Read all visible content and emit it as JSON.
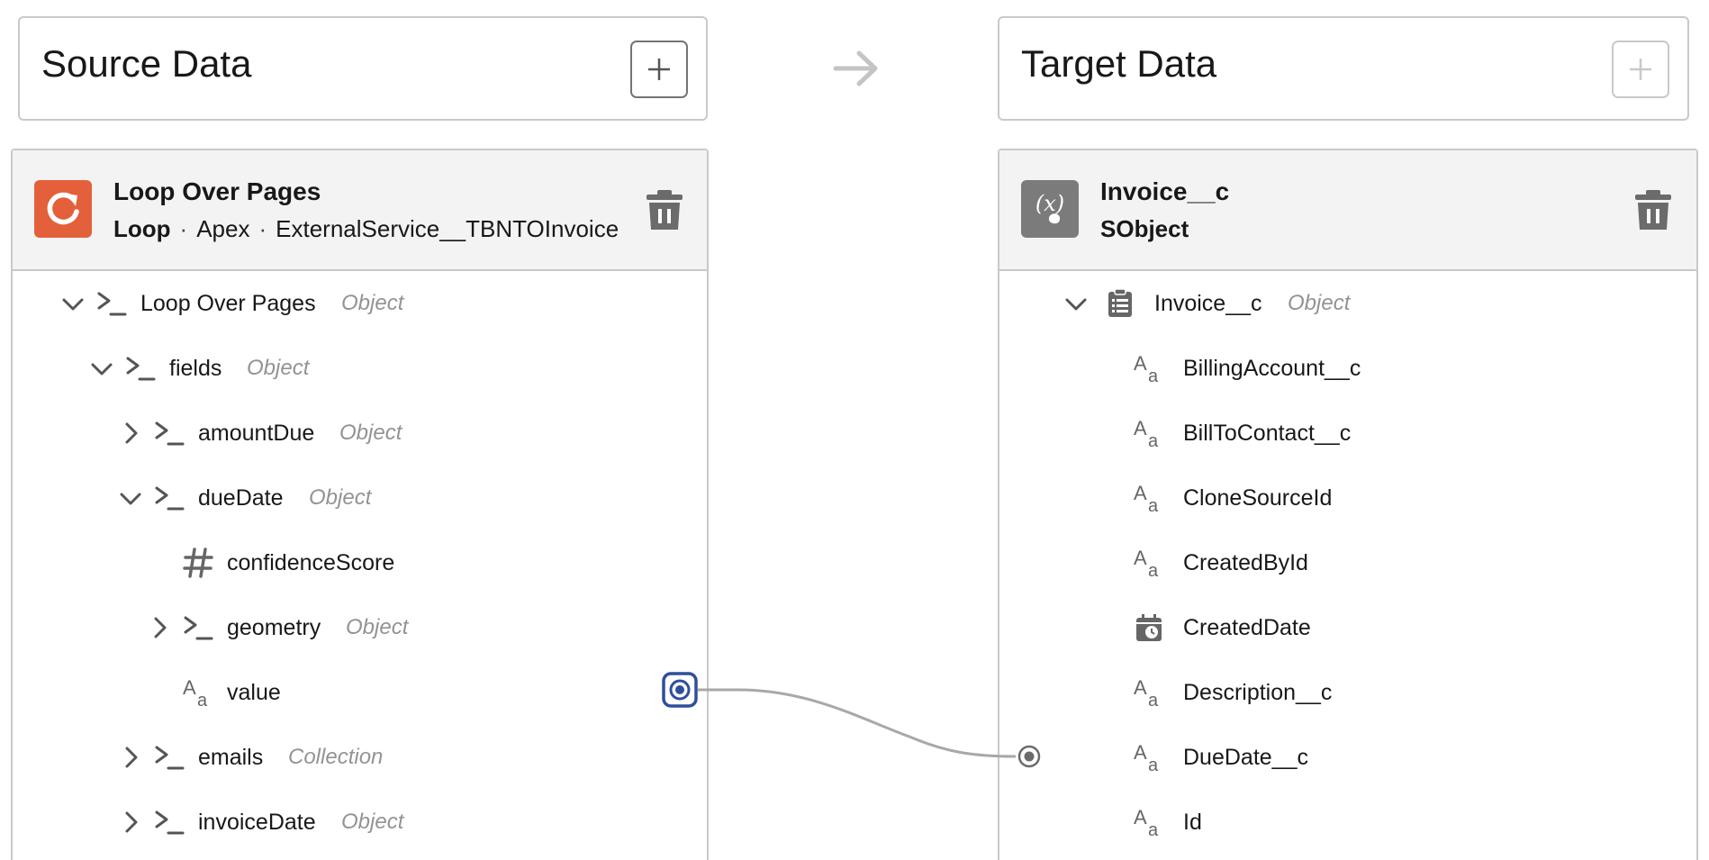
{
  "source_header": {
    "title": "Source Data"
  },
  "target_header": {
    "title": "Target Data"
  },
  "source_node": {
    "title": "Loop Over Pages",
    "type": "Loop",
    "origin": "Apex",
    "service": "ExternalService__TBNTOInvoice",
    "icon_color": "#e4603a"
  },
  "target_node": {
    "title": "Invoice__c",
    "type": "SObject",
    "icon_color": "#7b7b7b"
  },
  "source_tree": [
    {
      "label": "Loop Over Pages",
      "type": "Object",
      "icon": "formula-icon",
      "chevron": "down"
    },
    {
      "label": "fields",
      "type": "Object",
      "icon": "formula-icon",
      "chevron": "down"
    },
    {
      "label": "amountDue",
      "type": "Object",
      "icon": "formula-icon",
      "chevron": "right"
    },
    {
      "label": "dueDate",
      "type": "Object",
      "icon": "formula-icon",
      "chevron": "down"
    },
    {
      "label": "confidenceScore",
      "type": "",
      "icon": "number-icon",
      "chevron": ""
    },
    {
      "label": "geometry",
      "type": "Object",
      "icon": "formula-icon",
      "chevron": "right"
    },
    {
      "label": "value",
      "type": "",
      "icon": "text-icon",
      "chevron": ""
    },
    {
      "label": "emails",
      "type": "Collection",
      "icon": "formula-icon",
      "chevron": "right"
    },
    {
      "label": "invoiceDate",
      "type": "Object",
      "icon": "formula-icon",
      "chevron": "right"
    }
  ],
  "target_tree": [
    {
      "label": "Invoice__c",
      "type": "Object",
      "icon": "record-icon",
      "chevron": "down"
    },
    {
      "label": "BillingAccount__c",
      "type": "",
      "icon": "text-icon"
    },
    {
      "label": "BillToContact__c",
      "type": "",
      "icon": "text-icon"
    },
    {
      "label": "CloneSourceId",
      "type": "",
      "icon": "text-icon"
    },
    {
      "label": "CreatedById",
      "type": "",
      "icon": "text-icon"
    },
    {
      "label": "CreatedDate",
      "type": "",
      "icon": "datetime-icon"
    },
    {
      "label": "Description__c",
      "type": "",
      "icon": "text-icon"
    },
    {
      "label": "DueDate__c",
      "type": "",
      "icon": "text-icon"
    },
    {
      "label": "Id",
      "type": "",
      "icon": "text-icon"
    }
  ],
  "mapping": {
    "from": "value",
    "to": "DueDate__c",
    "line_color": "#a8a8a8",
    "port_color": "#2e4f9c"
  }
}
